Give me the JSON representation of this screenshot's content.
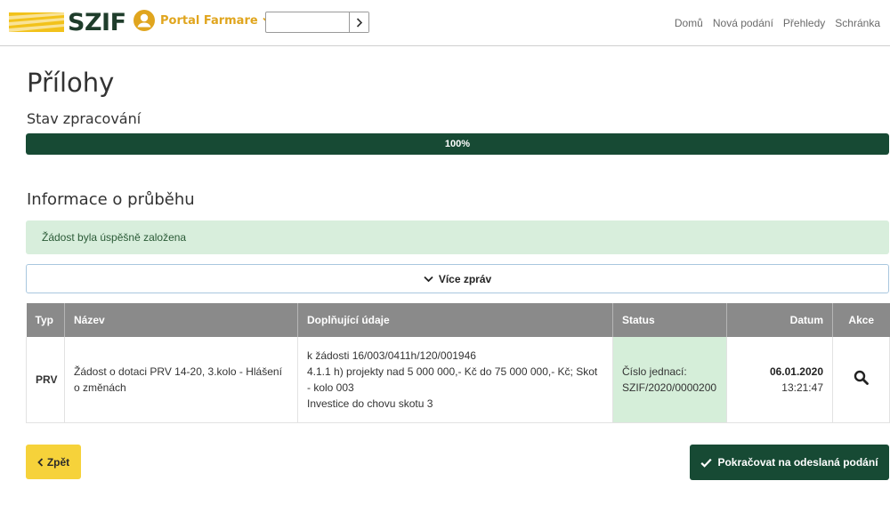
{
  "header": {
    "logo_text": "SZIF",
    "portal_label": "Portal Farmare",
    "search": {
      "value": "",
      "placeholder": ""
    },
    "nav": [
      "Domů",
      "Nová podání",
      "Přehledy",
      "Schránka"
    ]
  },
  "page": {
    "title": "Přílohy",
    "progress_label": "Stav zpracování",
    "progress_value": 100,
    "progress_text": "100%",
    "info_title": "Informace o průběhu",
    "alert_text": "Žádost byla úspěšně založena",
    "more_button": "Více zpráv"
  },
  "table": {
    "headers": [
      "Typ",
      "Název",
      "Doplňující údaje",
      "Status",
      "Datum",
      "Akce"
    ],
    "rows": [
      {
        "typ": "PRV",
        "nazev": "Žádost o dotaci PRV 14-20, 3.kolo - Hlášení o změnách",
        "doplnujici": [
          "k žádosti 16/003/0411h/120/001946",
          "4.1.1 h) projekty nad 5 000 000,- Kč do 75 000 000,- Kč; Skot - kolo 003",
          "Investice do chovu skotu 3"
        ],
        "status": "Číslo jednací: SZIF/2020/0000200",
        "datum": "06.01.2020",
        "cas": "13:21:47"
      }
    ]
  },
  "buttons": {
    "back": "Zpět",
    "continue": "Pokračovat na odeslaná podání"
  },
  "colors": {
    "brand_green": "#174a34",
    "brand_yellow": "#f6d23a",
    "portal_orange": "#e0a51e",
    "success_bg": "#d8eedc",
    "table_header": "#8a8a8a"
  },
  "icons": {
    "logo": "szif-logo-stripes",
    "user": "user-circle-icon",
    "chevron": "chevron-down-icon",
    "search_go": "chevron-right-icon",
    "row_action": "search-icon",
    "back": "chevron-left-icon",
    "continue": "check-icon"
  }
}
